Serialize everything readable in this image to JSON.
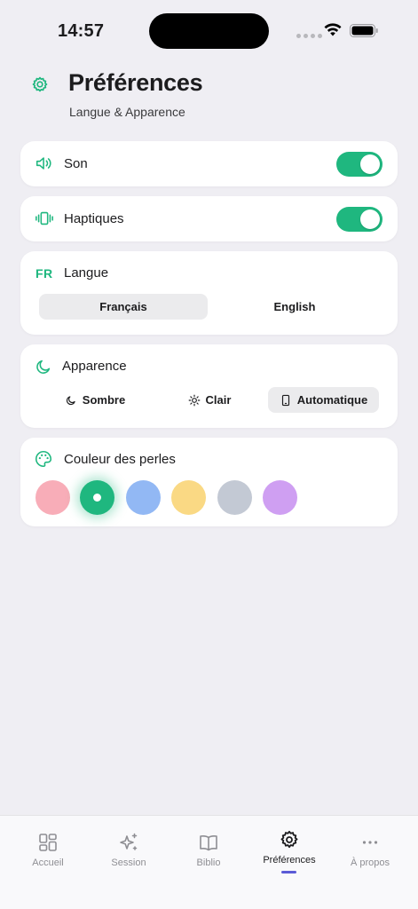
{
  "status_bar": {
    "time": "14:57"
  },
  "header": {
    "title": "Préférences",
    "subtitle": "Langue & Apparence",
    "icon": "gear-icon"
  },
  "sound": {
    "label": "Son",
    "enabled": true,
    "icon": "speaker-icon"
  },
  "haptics": {
    "label": "Haptiques",
    "enabled": true,
    "icon": "vibration-icon"
  },
  "language": {
    "badge": "FR",
    "label": "Langue",
    "options": [
      "Français",
      "English"
    ],
    "selected": "Français"
  },
  "appearance": {
    "label": "Apparence",
    "icon": "moon-icon",
    "options": [
      {
        "label": "Sombre",
        "icon": "moon-icon"
      },
      {
        "label": "Clair",
        "icon": "sun-icon"
      },
      {
        "label": "Automatique",
        "icon": "phone-icon"
      }
    ],
    "selected": "Automatique"
  },
  "bead_color": {
    "label": "Couleur des perles",
    "icon": "palette-icon",
    "colors": [
      "#f8adb8",
      "#1fb77f",
      "#92b8f4",
      "#fad984",
      "#c3c9d4",
      "#cf9ff2"
    ],
    "selected_index": 1
  },
  "accent_color": "#1fb77f",
  "tab_bar": {
    "tabs": [
      {
        "label": "Accueil",
        "icon": "grid-icon"
      },
      {
        "label": "Session",
        "icon": "sparkle-icon"
      },
      {
        "label": "Biblio",
        "icon": "book-icon"
      },
      {
        "label": "Préférences",
        "icon": "gear-icon"
      },
      {
        "label": "À propos",
        "icon": "more-icon"
      }
    ],
    "active_index": 3
  }
}
